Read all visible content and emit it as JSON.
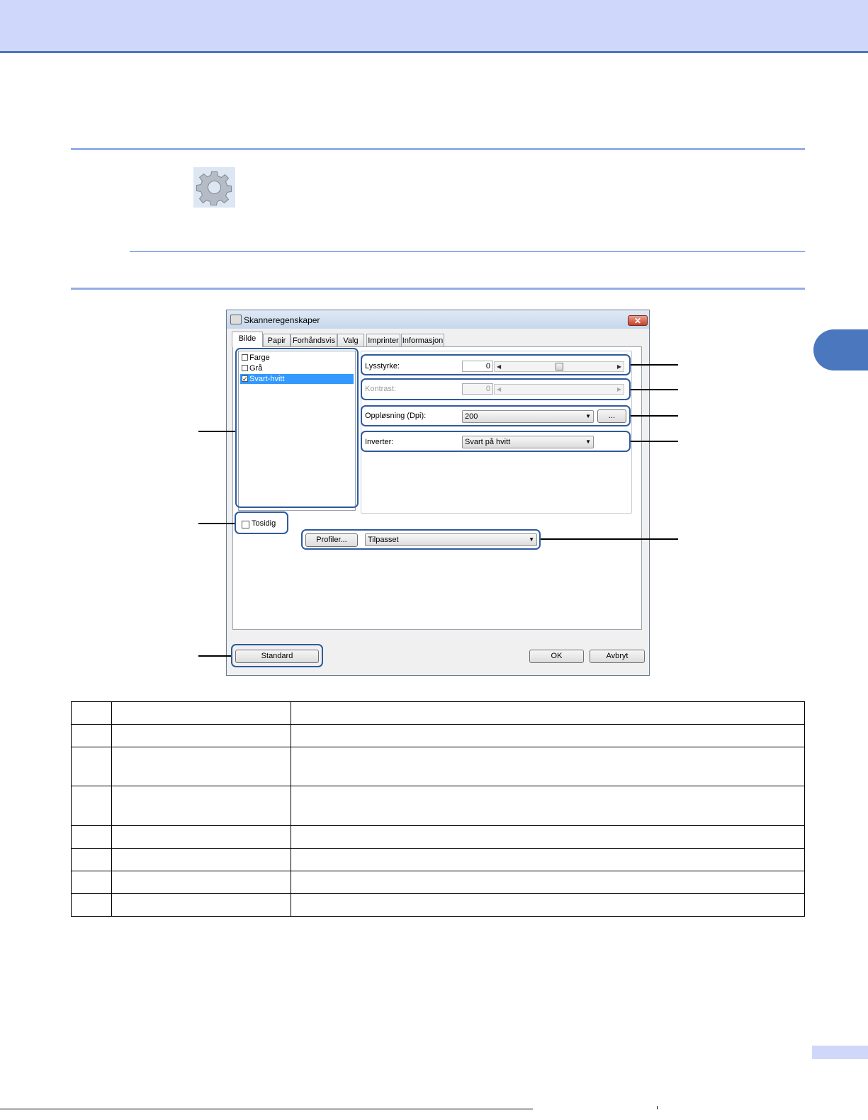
{
  "page": {
    "colors": {
      "header_band": "#cfd8fb",
      "accent": "#4a77bd",
      "rule": "#93aee6"
    }
  },
  "settings_icon": {
    "icon": "gear-icon"
  },
  "dialog": {
    "title": "Skanneregenskaper",
    "close_label": "✕",
    "tabs": [
      "Bilde",
      "Papir",
      "Forhåndsvis",
      "Valg",
      "Imprinter",
      "Informasjon"
    ],
    "image_types": [
      {
        "label": "Farge",
        "checked": false
      },
      {
        "label": "Grå",
        "checked": false
      },
      {
        "label": "Svart-hvitt",
        "checked": true
      }
    ],
    "brightness": {
      "label": "Lysstyrke:",
      "value": "0"
    },
    "contrast": {
      "label": "Kontrast:",
      "value": "0"
    },
    "resolution": {
      "label": "Oppløsning (Dpi):",
      "value": "200",
      "more_label": "..."
    },
    "invert": {
      "label": "Inverter:",
      "value": "Svart på hvitt"
    },
    "duplex": {
      "label": "Tosidig",
      "checked": false
    },
    "profiles": {
      "button_label": "Profiler...",
      "value": "Tilpasset"
    },
    "buttons": {
      "standard": "Standard",
      "ok": "OK",
      "cancel": "Avbryt"
    }
  },
  "table": {
    "rows": 8,
    "cols": 3
  }
}
